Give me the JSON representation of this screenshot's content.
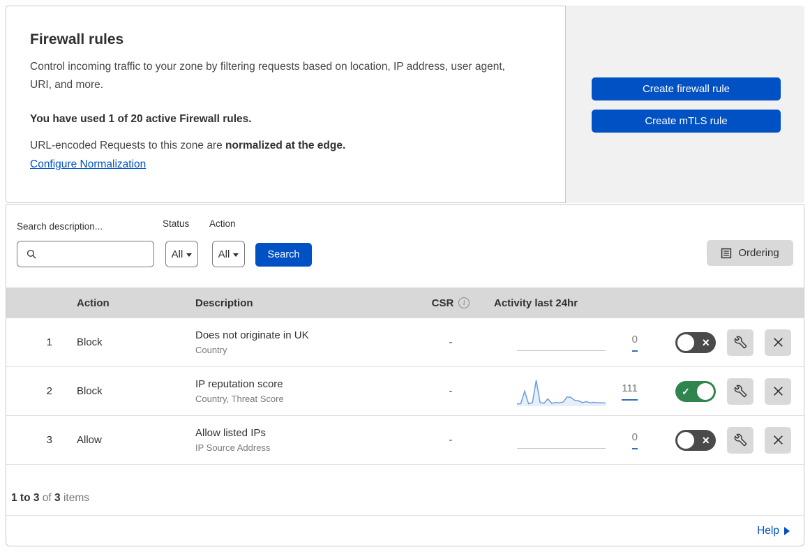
{
  "header": {
    "title": "Firewall rules",
    "description": "Control incoming traffic to your zone by filtering requests based on location, IP address, user agent, URI, and more.",
    "usage": "You have used 1 of 20 active Firewall rules.",
    "normalization_prefix": "URL-encoded Requests to this zone are ",
    "normalization_bold": "normalized at the edge.",
    "normalization_link": "Configure Normalization",
    "create_firewall_button": "Create firewall rule",
    "create_mtls_button": "Create mTLS rule"
  },
  "filters": {
    "search_label": "Search description...",
    "search_value": "",
    "status_label": "Status",
    "status_value": "All",
    "action_label": "Action",
    "action_value": "All",
    "search_button": "Search",
    "ordering_button": "Ordering"
  },
  "table": {
    "columns": {
      "action": "Action",
      "description": "Description",
      "csr": "CSR",
      "activity": "Activity last 24hr"
    },
    "rows": [
      {
        "index": "1",
        "action": "Block",
        "description": "Does not originate in UK",
        "fields": "Country",
        "csr": "-",
        "count": "0",
        "enabled": false,
        "sparkline": []
      },
      {
        "index": "2",
        "action": "Block",
        "description": "IP reputation score",
        "fields": "Country, Threat Score",
        "csr": "-",
        "count": "111",
        "enabled": true,
        "sparkline": [
          3,
          5,
          55,
          4,
          8,
          100,
          9,
          6,
          24,
          6,
          9,
          8,
          11,
          32,
          30,
          18,
          16,
          9,
          13,
          8,
          10,
          8,
          8,
          7
        ]
      },
      {
        "index": "3",
        "action": "Allow",
        "description": "Allow listed IPs",
        "fields": "IP Source Address",
        "csr": "-",
        "count": "0",
        "enabled": false,
        "sparkline": []
      }
    ]
  },
  "footer": {
    "range": "1 to 3",
    "of": " of ",
    "total": "3",
    "items": " items",
    "help": "Help"
  },
  "chart_data": {
    "type": "area",
    "title": "Activity last 24hr sparkline (rule 2: IP reputation score, total 111)",
    "x_label": "last 24 hours",
    "series": [
      {
        "name": "rule-1-activity",
        "values": [
          0,
          0,
          0,
          0,
          0,
          0,
          0,
          0,
          0,
          0,
          0,
          0,
          0,
          0,
          0,
          0,
          0,
          0,
          0,
          0,
          0,
          0,
          0,
          0
        ]
      },
      {
        "name": "rule-2-activity",
        "values": [
          3,
          5,
          55,
          4,
          8,
          100,
          9,
          6,
          24,
          6,
          9,
          8,
          11,
          32,
          30,
          18,
          16,
          9,
          13,
          8,
          10,
          8,
          8,
          7
        ]
      },
      {
        "name": "rule-3-activity",
        "values": [
          0,
          0,
          0,
          0,
          0,
          0,
          0,
          0,
          0,
          0,
          0,
          0,
          0,
          0,
          0,
          0,
          0,
          0,
          0,
          0,
          0,
          0,
          0,
          0
        ]
      }
    ],
    "legend": false,
    "grid": false
  },
  "colors": {
    "accent_blue": "#0051c3",
    "toggle_on": "#2f854d",
    "toggle_off": "#4a4a4a",
    "spark": "#6b9ce0",
    "header_bg": "#d8d8d8",
    "panel_bg": "#f1f1f1",
    "btn_gray": "#d9d9d9"
  }
}
